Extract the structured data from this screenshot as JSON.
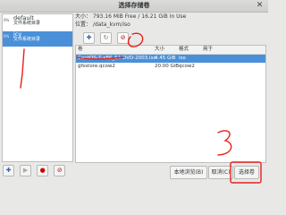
{
  "window": {
    "title": "选择存储卷",
    "close_icon": "close-icon"
  },
  "sidebar": {
    "pools": [
      {
        "icon": "storage-pool-icon",
        "icon_label": "0%",
        "name": "default",
        "subtitle": "文件系统目录",
        "selected": false
      },
      {
        "icon": "storage-pool-icon",
        "icon_label": "0%",
        "name": "jcy",
        "subtitle": "文件系统目录",
        "selected": true
      }
    ],
    "tools": [
      "add-pool-icon",
      "start-pool-icon",
      "stop-pool-icon",
      "delete-pool-icon"
    ]
  },
  "pool_info": {
    "size_label": "大小：",
    "size_value": "793.16 MiB Free / 16.21 GiB In Use",
    "location_label": "位置：",
    "location_value": "/data_kvm/iso"
  },
  "volume_tools": [
    "add-volume-icon",
    "refresh-icon",
    "delete-volume-icon"
  ],
  "table": {
    "columns": [
      "卷",
      "大小",
      "格式",
      "用于"
    ],
    "rows": [
      {
        "name": "CentOS-7-x86_64-DVD-2003.iso",
        "size": "4.45 GiB",
        "format": "iso",
        "used_by": "",
        "selected": true
      },
      {
        "name": "gfsstore.qcow2",
        "size": "20.00 GiB",
        "format": "qcow2",
        "used_by": "",
        "selected": false
      }
    ]
  },
  "buttons": {
    "browse_local": "本地浏览(B)",
    "cancel": "取消(C)",
    "choose_volume": "选择卷"
  },
  "annotations": {
    "numbers": [
      "1",
      "2",
      "3"
    ],
    "color": "#e8201a"
  },
  "colors": {
    "selection": "#4a90d9",
    "annotation": "#e8201a",
    "stop": "#cc0000"
  }
}
